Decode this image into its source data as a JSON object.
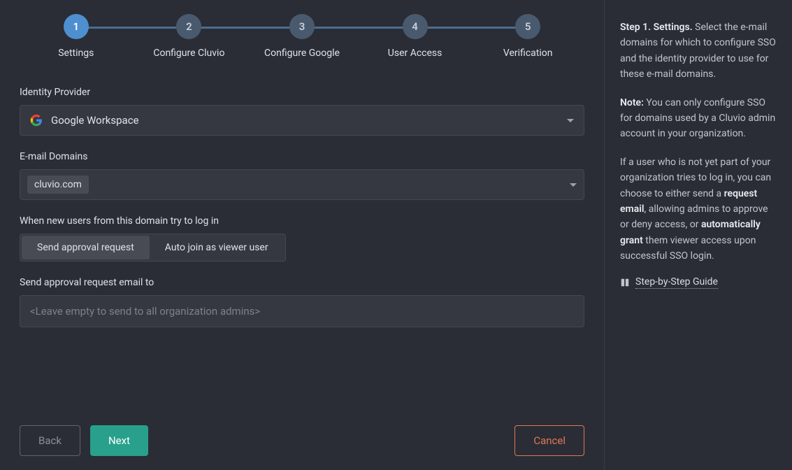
{
  "stepper": {
    "steps": [
      {
        "num": "1",
        "label": "Settings",
        "active": true
      },
      {
        "num": "2",
        "label": "Configure Cluvio",
        "active": false
      },
      {
        "num": "3",
        "label": "Configure Google",
        "active": false
      },
      {
        "num": "4",
        "label": "User Access",
        "active": false
      },
      {
        "num": "5",
        "label": "Verification",
        "active": false
      }
    ]
  },
  "form": {
    "identity_provider": {
      "label": "Identity Provider",
      "value": "Google Workspace"
    },
    "email_domains": {
      "label": "E-mail Domains",
      "tag": "cluvio.com"
    },
    "new_users": {
      "label": "When new users from this domain try to log in",
      "option_a": "Send approval request",
      "option_b": "Auto join as viewer user"
    },
    "approval_email": {
      "label": "Send approval request email to",
      "placeholder": "<Leave empty to send to all organization admins>"
    }
  },
  "buttons": {
    "back": "Back",
    "next": "Next",
    "cancel": "Cancel"
  },
  "sidebar": {
    "p1_strong": "Step 1. Settings.",
    "p1_text": " Select the e-mail domains for which to configure SSO and the identity provider to use for these e-mail domains.",
    "p2_strong": "Note:",
    "p2_text": " You can only configure SSO for domains used by a Cluvio admin account in your organization.",
    "p3_a": "If a user who is not yet part of your organization tries to log in, you can choose to either send a ",
    "p3_strong1": "request email",
    "p3_b": ", allowing admins to approve or deny access, or ",
    "p3_strong2": "automatically grant",
    "p3_c": " them viewer access upon successful SSO login.",
    "guide_link": "Step-by-Step Guide"
  }
}
